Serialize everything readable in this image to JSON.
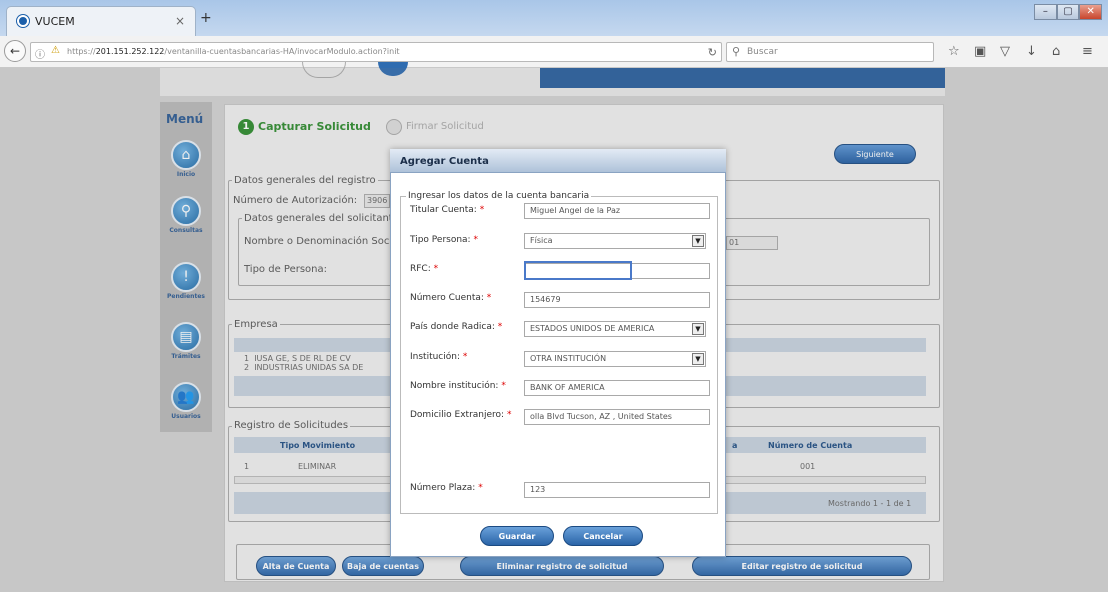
{
  "browser": {
    "tab_title": "VUCEM",
    "tab_close": "×",
    "new_tab": "+",
    "url_prefix": "https://",
    "url_host": "201.151.252.122",
    "url_path": "/ventanilla-cuentasbancarias-HA/invocarModulo.action?init",
    "search_placeholder": "Buscar",
    "window_controls": [
      "–",
      "▢",
      "✕"
    ]
  },
  "sidebar": {
    "title": "Menú",
    "items": [
      {
        "label": "Inicio",
        "icon": "home-icon",
        "glyph": "⌂"
      },
      {
        "label": "Consultas",
        "icon": "search-icon",
        "glyph": "⚲"
      },
      {
        "label": "Pendientes",
        "icon": "alert-icon",
        "glyph": "!"
      },
      {
        "label": "Trámites",
        "icon": "document-icon",
        "glyph": "▤"
      },
      {
        "label": "Usuarios",
        "icon": "users-icon",
        "glyph": "👥"
      }
    ]
  },
  "steps": {
    "step1_num": "1",
    "step1": "Capturar Solicitud",
    "step2": "Firmar Solicitud",
    "next": "Siguiente"
  },
  "background_form": {
    "general_legend": "Datos generales del registro",
    "auth_label": "Número de Autorización:",
    "auth_value": "3906",
    "applicant_legend": "Datos generales del solicitante",
    "name_label": "Nombre o Denominación Social",
    "person_type_label": "Tipo de Persona:",
    "hidden_value": "01",
    "company_legend": "Empresa",
    "companies": [
      {
        "num": "1",
        "name": "IUSA GE, S DE RL DE CV"
      },
      {
        "num": "2",
        "name": "INDUSTRIAS UNIDAS SA DE"
      }
    ],
    "requests_legend": "Registro de Solicitudes",
    "col_movement": "Tipo Movimiento",
    "col_account_number": "Número de Cuenta",
    "col_partial": "a",
    "request_rows": [
      {
        "num": "1",
        "movement": "ELIMINAR",
        "account": "001"
      }
    ],
    "showing": "Mostrando 1 - 1 de 1",
    "btn_add_account": "Alta de Cuenta",
    "btn_remove_account": "Baja de cuentas",
    "btn_delete_request": "Eliminar registro de solicitud",
    "btn_edit_request": "Editar registro de solicitud"
  },
  "modal": {
    "title": "Agregar Cuenta",
    "legend": "Ingresar los datos de la cuenta bancaria",
    "required_mark": "*",
    "fields": {
      "holder_label": "Titular Cuenta:",
      "holder_value": "Miguel Angel de la Paz",
      "person_type_label": "Tipo Persona:",
      "person_type_value": "Física",
      "rfc_label": "RFC:",
      "rfc_value": "",
      "account_label": "Número Cuenta:",
      "account_value": "154679",
      "country_label": "País donde Radica:",
      "country_value": "ESTADOS UNIDOS DE AMERICA",
      "institution_label": "Institución:",
      "institution_value": "OTRA INSTITUCIÓN",
      "institution_name_label": "Nombre institución:",
      "institution_name_value": "BANK OF AMERICA",
      "address_label": "Domicilio Extranjero:",
      "address_value": "olla Blvd   Tucson, AZ , United States",
      "plaza_label": "Número Plaza:",
      "plaza_value": "123"
    },
    "save": "Guardar",
    "cancel": "Cancelar"
  },
  "colors": {
    "accent": "#2a5f9e",
    "step_active": "#2e8b2e",
    "required": "#dd0000"
  }
}
